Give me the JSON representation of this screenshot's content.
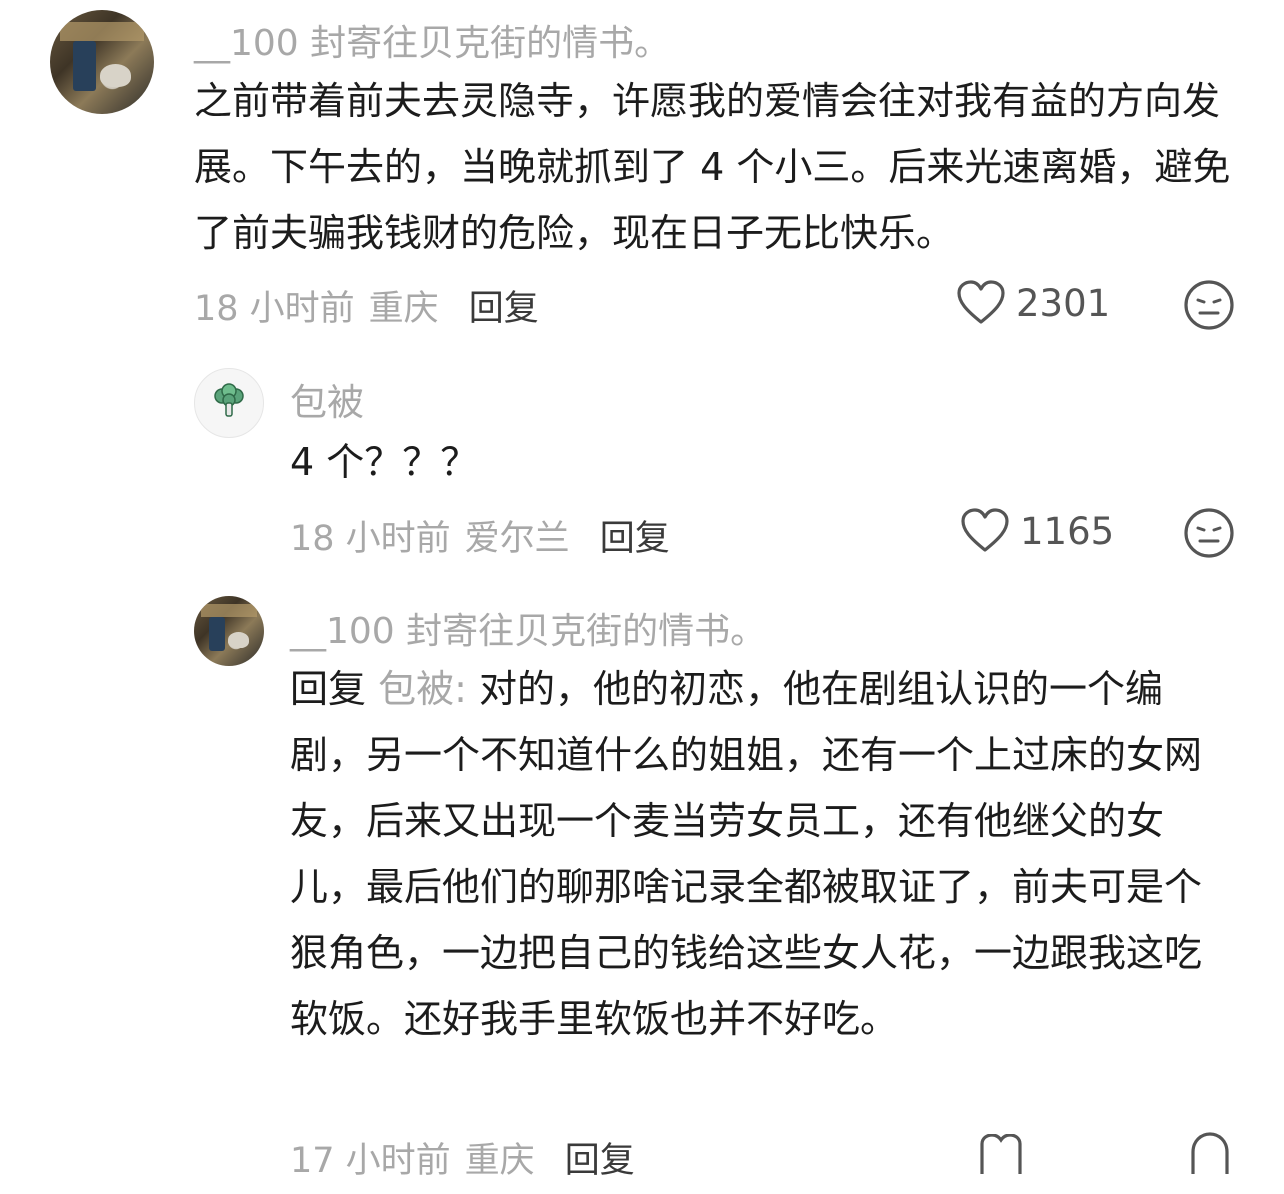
{
  "comments": [
    {
      "username": "__100 封寄往贝克街的情书。",
      "text": "之前带着前夫去灵隐寺，许愿我的爱情会往对我有益的方向发展。下午去的，当晚就抓到了 4 个小三。后来光速离婚，避免了前夫骗我钱财的危险，现在日子无比快乐。",
      "time": "18 小时前",
      "location": "重庆",
      "reply_label": "回复",
      "likes": "2301",
      "icons": {
        "like": "heart-icon",
        "dislike": "neutral-face-icon"
      }
    },
    {
      "username": "包被",
      "text": "4 个？？？",
      "time": "18 小时前",
      "location": "爱尔兰",
      "reply_label": "回复",
      "likes": "1165",
      "icons": {
        "avatar": "broccoli-icon",
        "like": "heart-icon",
        "dislike": "neutral-face-icon"
      }
    },
    {
      "username": "__100 封寄往贝克街的情书。",
      "reply_prefix": "回复",
      "reply_target": "包被:",
      "text": " 对的，他的初恋，他在剧组认识的一个编剧，另一个不知道什么的姐姐，还有一个上过床的女网友，后来又出现一个麦当劳女员工，还有他继父的女儿，最后他们的聊那啥记录全都被取证了，前夫可是个狠角色，一边把自己的钱给这些女人花，一边跟我这吃软饭。还好我手里软饭也并不好吃。",
      "time": "17 小时前",
      "location": "重庆",
      "reply_label": "回复"
    }
  ],
  "colors": {
    "text": "#1c1c1c",
    "muted": "#a8a8a8",
    "background": "#ffffff"
  }
}
